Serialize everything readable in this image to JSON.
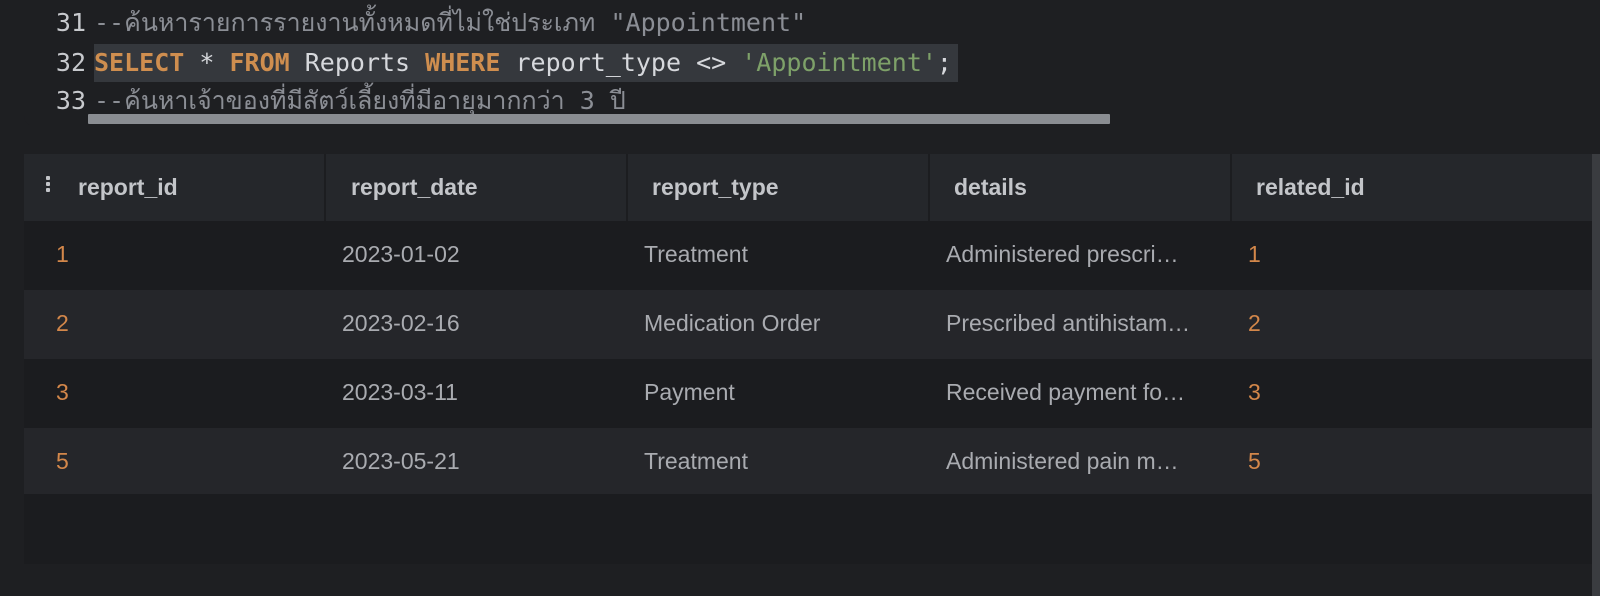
{
  "editor": {
    "lines": [
      {
        "number": "31",
        "comment": "--ค้นหารายการรายงานทั้งหมดที่ไม่ใช่ประเภท \"Appointment\""
      },
      {
        "number": "32",
        "kw1": "SELECT",
        "p1": " * ",
        "kw2": "FROM",
        "p2": " Reports ",
        "kw3": "WHERE",
        "p3": " report_type <> ",
        "str": "'Appointment'",
        "p4": ";"
      },
      {
        "number": "33",
        "comment": "--ค้นหาเจ้าของที่มีสัตว์เลี้ยงที่มีอายุมากกว่า 3 ปี"
      }
    ]
  },
  "results": {
    "columns": [
      "report_id",
      "report_date",
      "report_type",
      "details",
      "related_id"
    ],
    "rows": [
      {
        "report_id": "1",
        "report_date": "2023-01-02",
        "report_type": "Treatment",
        "details": "Administered prescri…",
        "related_id": "1"
      },
      {
        "report_id": "2",
        "report_date": "2023-02-16",
        "report_type": "Medication Order",
        "details": "Prescribed antihistam…",
        "related_id": "2"
      },
      {
        "report_id": "3",
        "report_date": "2023-03-11",
        "report_type": "Payment",
        "details": "Received payment fo…",
        "related_id": "3"
      },
      {
        "report_id": "5",
        "report_date": "2023-05-21",
        "report_type": "Treatment",
        "details": "Administered pain m…",
        "related_id": "5"
      }
    ]
  },
  "colors": {
    "keyword": "#cf8e4f",
    "string": "#7ea169",
    "comment": "#8b8e95",
    "number": "#d3874a",
    "background": "#1e1f22"
  },
  "icons": {
    "column_menu": "vertical-dots-icon"
  }
}
